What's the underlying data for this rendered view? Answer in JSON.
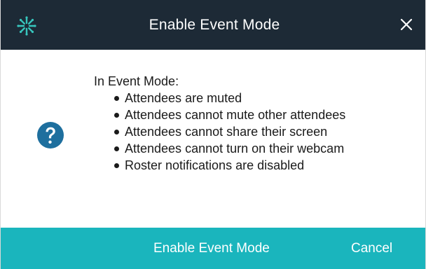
{
  "dialog": {
    "title": "Enable Event Mode",
    "close_glyph": "✕",
    "icons": {
      "logo": "asterisk-logo-icon",
      "close": "close-icon",
      "question": "question-icon"
    }
  },
  "message": {
    "intro": "In Event Mode:",
    "bullets": [
      "Attendees are muted",
      "Attendees cannot mute other attendees",
      "Attendees cannot share their screen",
      "Attendees cannot turn on their webcam",
      "Roster notifications are disabled"
    ]
  },
  "footer": {
    "enable_label": "Enable Event Mode",
    "cancel_label": "Cancel"
  },
  "colors": {
    "titlebar": "#1d2a36",
    "footer": "#1ab5bd",
    "logo": "#37c5bd",
    "question": "#1e6f9e"
  }
}
